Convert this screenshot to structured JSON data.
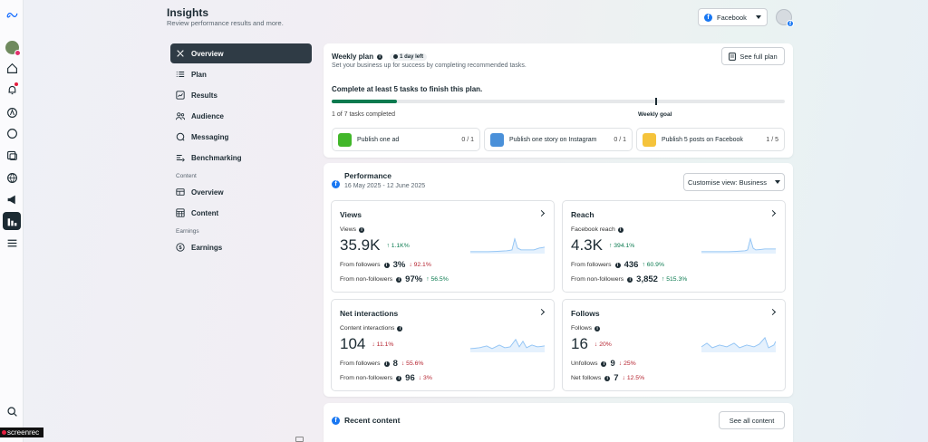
{
  "header": {
    "title": "Insights",
    "subtitle": "Review performance results and more.",
    "platform_selected": "Facebook"
  },
  "rail": {
    "icons": [
      "meta-logo",
      "profile-avatar",
      "home-icon",
      "notifications-icon",
      "ads-icon",
      "messages-icon",
      "content-icon",
      "globe-icon",
      "megaphone-icon",
      "insights-icon",
      "menu-icon",
      "search-icon"
    ]
  },
  "nav": {
    "items": [
      {
        "label": "Overview",
        "icon": "overview-icon",
        "active": true
      },
      {
        "label": "Plan",
        "icon": "plan-icon"
      },
      {
        "label": "Results",
        "icon": "results-icon"
      },
      {
        "label": "Audience",
        "icon": "audience-icon"
      },
      {
        "label": "Messaging",
        "icon": "messaging-icon"
      },
      {
        "label": "Benchmarking",
        "icon": "benchmarking-icon"
      }
    ],
    "content_section": "Content",
    "content_items": [
      {
        "label": "Overview",
        "icon": "content-overview-icon"
      },
      {
        "label": "Content",
        "icon": "content-icon"
      }
    ],
    "earnings_section": "Earnings",
    "earnings_items": [
      {
        "label": "Earnings",
        "icon": "earnings-icon"
      }
    ]
  },
  "weekly_plan": {
    "title": "Weekly plan",
    "time_left": "1 day left",
    "subtitle": "Set your business up for success by completing recommended tasks.",
    "see_full_plan": "See full plan",
    "goal_text": "Complete at least 5 tasks to finish this plan.",
    "tasks_completed": "1 of 7 tasks completed",
    "progress_fraction": 0.143,
    "weekly_goal_fraction": 0.714,
    "weekly_goal_label": "Weekly goal",
    "tasks": [
      {
        "label": "Publish one ad",
        "count": "0 / 1",
        "thumb_color": "#42b72a"
      },
      {
        "label": "Publish one story on Instagram",
        "count": "0 / 1",
        "thumb_color": "#4a90d9"
      },
      {
        "label": "Publish 5 posts on Facebook",
        "count": "1 / 5",
        "thumb_color": "#f5c33b"
      }
    ]
  },
  "performance": {
    "title": "Performance",
    "date_range": "16 May 2025 - 12 June 2025",
    "customise": "Customise view: Business",
    "metrics": {
      "views": {
        "title": "Views",
        "label": "Views",
        "value": "35.9K",
        "change": "1.1K%",
        "row1_label": "From followers",
        "row1_value": "3%",
        "row1_change": "92.1%",
        "row2_label": "From non-followers",
        "row2_value": "97%",
        "row2_change": "56.5%"
      },
      "reach": {
        "title": "Reach",
        "label": "Facebook reach",
        "value": "4.3K",
        "change": "394.1%",
        "row1_label": "From followers",
        "row1_value": "436",
        "row1_change": "60.9%",
        "row2_label": "From non-followers",
        "row2_value": "3,852",
        "row2_change": "515.3%"
      },
      "interactions": {
        "title": "Net interactions",
        "label": "Content interactions",
        "value": "104",
        "change": "11.1%",
        "row1_label": "From followers",
        "row1_value": "8",
        "row1_change": "55.6%",
        "row2_label": "From non-followers",
        "row2_value": "96",
        "row2_change": "3%"
      },
      "follows": {
        "title": "Follows",
        "label": "Follows",
        "value": "16",
        "change": "20%",
        "row1_label": "Unfollows",
        "row1_value": "9",
        "row1_change": "25%",
        "row2_label": "Net follows",
        "row2_value": "7",
        "row2_change": "12.5%"
      }
    }
  },
  "recent": {
    "title": "Recent content",
    "see_all": "See all content"
  },
  "watermark": "screenrec",
  "colors": {
    "accent": "#1877f2",
    "positive": "#0a7a4f",
    "negative": "#b5232f",
    "active_nav": "#2f3b45"
  }
}
